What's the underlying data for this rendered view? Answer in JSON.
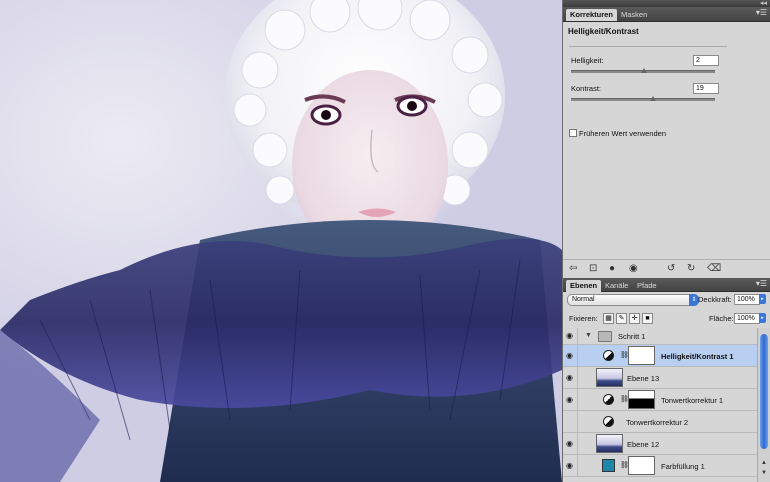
{
  "adjustments_panel": {
    "tabs": [
      "Korrekturen",
      "Masken"
    ],
    "title": "Helligkeit/Kontrast",
    "brightness_label": "Helligkeit:",
    "brightness_value": "2",
    "contrast_label": "Kontrast:",
    "contrast_value": "19",
    "use_legacy_label": "Früheren Wert verwenden",
    "brightness_slider_fraction": 0.51,
    "contrast_slider_fraction": 0.57
  },
  "layers_panel": {
    "tabs": [
      "Ebenen",
      "Kanäle",
      "Pfade"
    ],
    "blend_mode": "Normal",
    "opacity_label": "Deckkraft:",
    "opacity_value": "100%",
    "lock_label": "Fixieren:",
    "fill_label": "Fläche:",
    "fill_value": "100%",
    "layers": [
      {
        "name": "Schritt 1",
        "kind": "group"
      },
      {
        "name": "Helligkeit/Kontrast 1",
        "kind": "adjustment",
        "selected": true
      },
      {
        "name": "Ebene 13",
        "kind": "photo"
      },
      {
        "name": "Tonwertkorrektur 1",
        "kind": "adjustment-mask"
      },
      {
        "name": "Tonwertkorrektur 2",
        "kind": "adjustment-nomask"
      },
      {
        "name": "Ebene 12",
        "kind": "photo"
      },
      {
        "name": "Farbfüllung 1",
        "kind": "fill"
      }
    ]
  },
  "icons": {
    "eye": "eye-icon",
    "chain": "link-icon",
    "folder": "folder-icon",
    "menu": "panel-menu-icon"
  },
  "colors": {
    "selection": "#b9cff1",
    "fill_swatch": "#1f87a9",
    "accent_blue": "#3b76d6"
  }
}
